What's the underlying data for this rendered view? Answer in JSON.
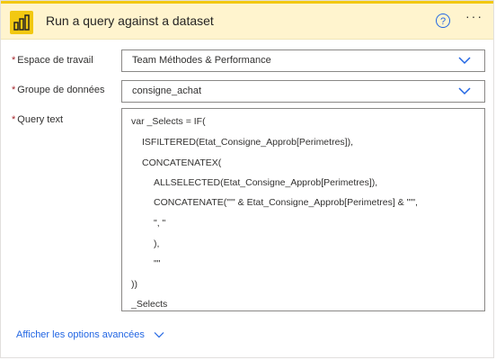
{
  "action": {
    "title": "Run a query against a dataset",
    "help_glyph": "?",
    "more_glyph": "···"
  },
  "fields": {
    "workspace": {
      "required_marker": "*",
      "label": "Espace de travail",
      "value": "Team Méthodes & Performance"
    },
    "dataset": {
      "required_marker": "*",
      "label": "Groupe de données",
      "value": "consigne_achat"
    },
    "query": {
      "required_marker": "*",
      "label": "Query text",
      "lines": [
        "var _Selects = IF(",
        "ISFILTERED(Etat_Consigne_Approb[Perimetres]),",
        "CONCATENATEX(",
        "ALLSELECTED(Etat_Consigne_Approb[Perimetres]),",
        "CONCATENATE(\"'\" & Etat_Consigne_Approb[Perimetres] & \"'\",",
        "\", \"",
        "),",
        "\"\"",
        "))",
        "_Selects"
      ]
    }
  },
  "advanced_options": {
    "label": "Afficher les options avancées"
  },
  "colors": {
    "brand": "#f2c811",
    "header_bg": "#fff4ce",
    "link": "#2266e3",
    "required": "#a4262c"
  }
}
